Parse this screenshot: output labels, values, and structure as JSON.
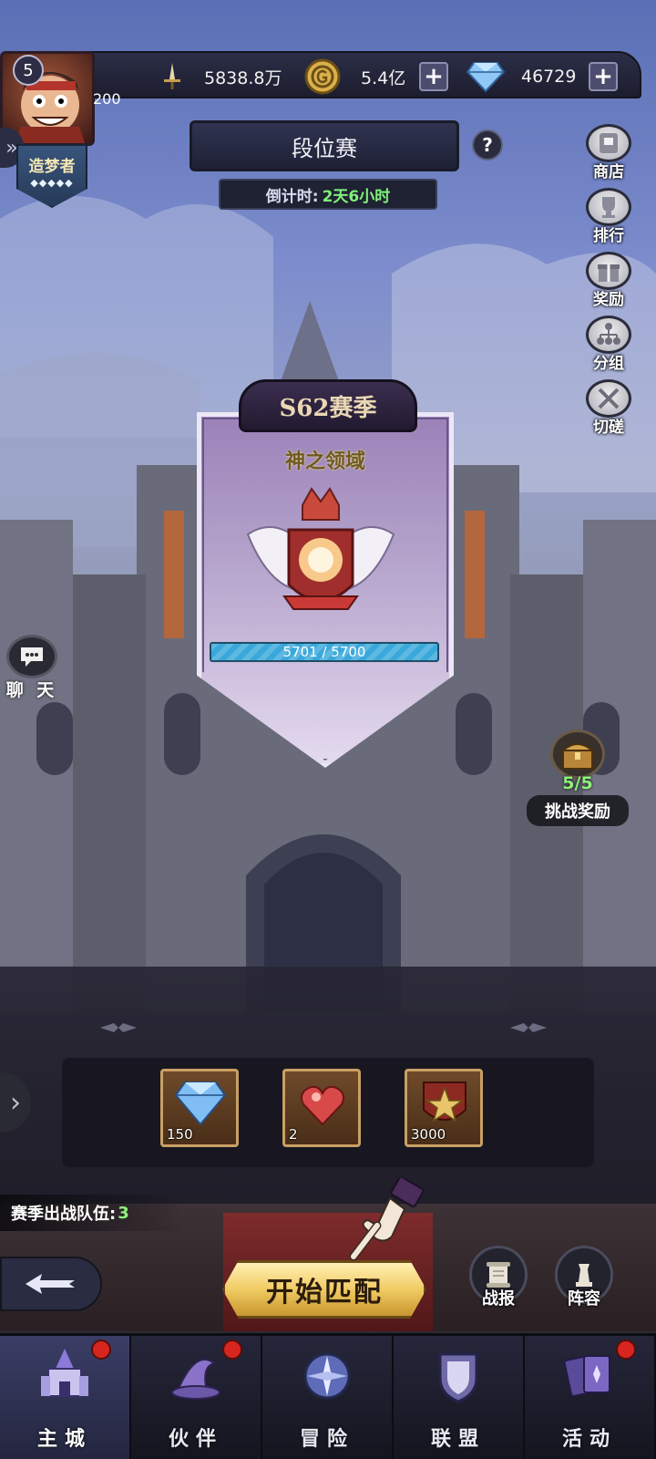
{
  "player": {
    "level": "5",
    "power": "200",
    "title": "造梦者"
  },
  "resources": {
    "combat_power": "5838.8万",
    "gold": "5.4亿",
    "diamonds": "46729"
  },
  "header": {
    "title": "段位赛",
    "countdown_label": "倒计时:",
    "countdown_value": "2天6小时"
  },
  "right_menu": [
    {
      "label": "商店",
      "icon": "shop-icon"
    },
    {
      "label": "排行",
      "icon": "trophy-icon"
    },
    {
      "label": "奖励",
      "icon": "gift-icon"
    },
    {
      "label": "分组",
      "icon": "group-icon"
    },
    {
      "label": "切磋",
      "icon": "swords-icon"
    }
  ],
  "season": {
    "name": "S62赛季",
    "rank_name": "神之领域",
    "progress_text": "5701 / 5700",
    "progress_fraction": 1.0
  },
  "chat": {
    "label": "聊 天"
  },
  "challenge_reward": {
    "count": "5/5",
    "label": "挑战奖励"
  },
  "rewards": [
    {
      "icon": "diamond-icon",
      "qty": "150"
    },
    {
      "icon": "heart-potion-icon",
      "qty": "2"
    },
    {
      "icon": "star-medal-icon",
      "qty": "3000"
    }
  ],
  "team": {
    "label": "赛季出战队伍:",
    "count": "3"
  },
  "actions": {
    "match": "开始匹配",
    "report": "战报",
    "lineup": "阵容"
  },
  "nav": [
    {
      "label": "主城",
      "icon": "castle-icon",
      "active": true,
      "badge": true
    },
    {
      "label": "伙伴",
      "icon": "wizard-hat-icon",
      "active": false,
      "badge": true
    },
    {
      "label": "冒险",
      "icon": "compass-icon",
      "active": false,
      "badge": false
    },
    {
      "label": "联盟",
      "icon": "shield-icon",
      "active": false,
      "badge": false
    },
    {
      "label": "活动",
      "icon": "cards-icon",
      "active": false,
      "badge": true
    }
  ],
  "colors": {
    "accent_green": "#8ff27a",
    "badge_red": "#d7261f",
    "progress_blue": "#3aa8da",
    "gold_button": "#f1cb63"
  }
}
